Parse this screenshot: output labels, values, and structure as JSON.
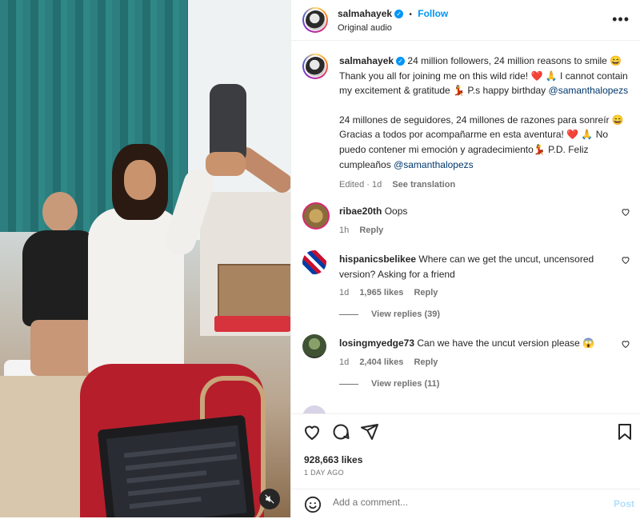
{
  "post": {
    "username": "salmahayek",
    "follow_label": "Follow",
    "separator": "•",
    "audio": "Original audio",
    "more_label": "•••"
  },
  "caption": {
    "username": "salmahayek",
    "text_en": "24 million followers, 24 million reasons to smile 😄 Thank you all for joining me on this wild ride! ❤️ 🙏 I cannot contain my excitement & gratitude 💃 P.s happy birthday",
    "mention_en": "@samanthalopezs",
    "text_es": "24 millones de seguidores, 24 millones de razones para sonreír 😄 Gracias a todos por acompañarme en esta aventura! ❤️ 🙏 No puedo contener mi emoción y agradecimiento💃 P.D. Feliz cumpleaños",
    "mention_es": "@samanthalopezs",
    "edited": "Edited",
    "dot": "·",
    "age": "1d",
    "see_translation": "See translation"
  },
  "comments": [
    {
      "username": "ribae20th",
      "text": "Oops",
      "age": "1h",
      "likes": "",
      "reply_label": "Reply",
      "replies": ""
    },
    {
      "username": "hispanicsbelikee",
      "text": "Where can we get the uncut, uncensored version? Asking for a friend",
      "age": "1d",
      "likes": "1,965 likes",
      "reply_label": "Reply",
      "replies": "View replies (39)"
    },
    {
      "username": "losingmyedge73",
      "text": "Can we have the uncut version please 😱",
      "age": "1d",
      "likes": "2,404 likes",
      "reply_label": "Reply",
      "replies": "View replies (11)"
    }
  ],
  "stats": {
    "likes": "928,663 likes",
    "time": "1 DAY AGO"
  },
  "add_comment": {
    "placeholder": "Add a comment...",
    "post_label": "Post"
  },
  "colors": {
    "accent": "#0095f6",
    "verified": "#0095f6",
    "link": "#00376b",
    "muted": "#737373"
  },
  "icons": [
    "verified-badge-icon",
    "more-options-icon",
    "heart-icon",
    "comment-icon",
    "share-icon",
    "bookmark-icon",
    "emoji-icon",
    "mute-icon"
  ]
}
